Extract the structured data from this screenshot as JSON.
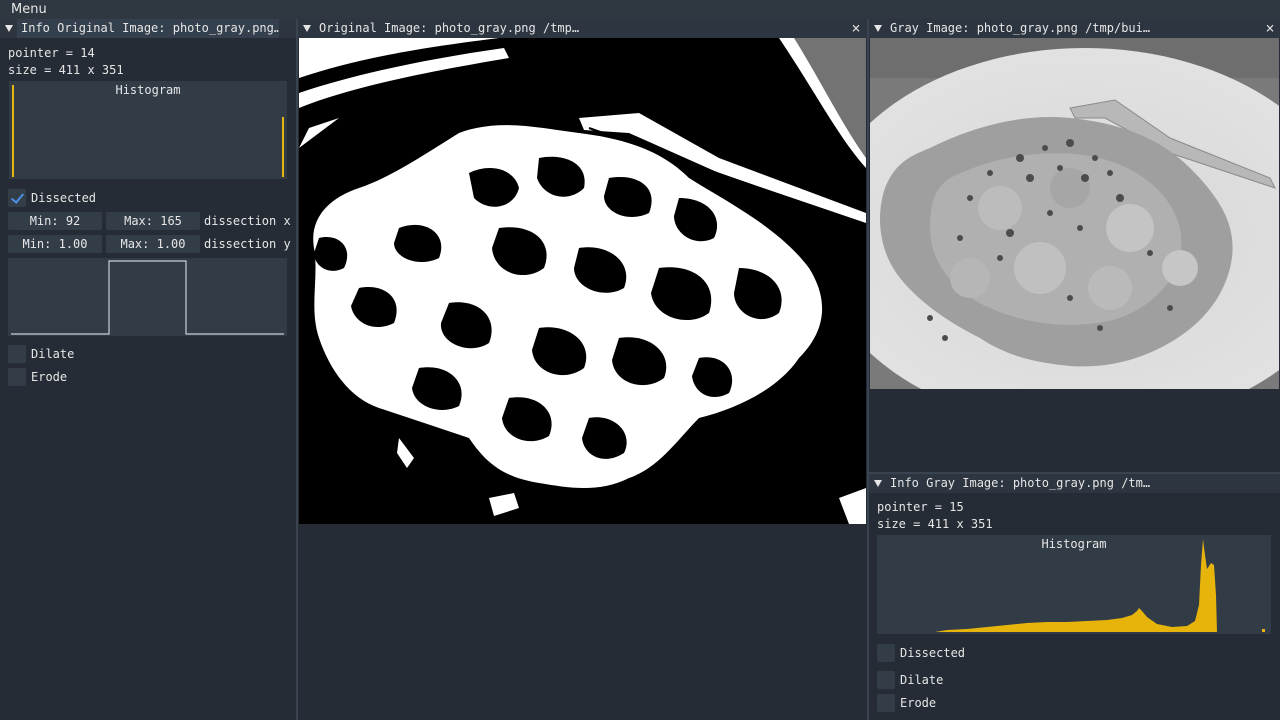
{
  "menu": {
    "label": "Menu"
  },
  "left_panel": {
    "title": "Info Original Image: photo_gray.png…",
    "pointer": "pointer = 14",
    "size": "size = 411 x 351",
    "histogram_title": "Histogram",
    "dissected": {
      "label": "Dissected",
      "checked": true
    },
    "range_x": {
      "min": "Min: 92",
      "max": "Max: 165",
      "label": "dissection x"
    },
    "range_y": {
      "min": "Min: 1.00",
      "max": "Max: 1.00",
      "label": "dissection y"
    },
    "dilate": {
      "label": "Dilate",
      "checked": false
    },
    "erode": {
      "label": "Erode",
      "checked": false
    }
  },
  "center_panel": {
    "title": "Original Image: photo_gray.png /tmp…",
    "close": "×"
  },
  "right_top_panel": {
    "title": "Gray Image: photo_gray.png /tmp/bui…",
    "close": "×"
  },
  "right_bottom_panel": {
    "title": "Info Gray Image: photo_gray.png /tm…",
    "pointer": "pointer = 15",
    "size": "size = 411 x 351",
    "histogram_title": "Histogram",
    "dissected": {
      "label": "Dissected",
      "checked": false
    },
    "dilate": {
      "label": "Dilate",
      "checked": false
    },
    "erode": {
      "label": "Erode",
      "checked": false
    }
  },
  "colors": {
    "histogram": "#e6b40b",
    "background": "#252c35",
    "checkmark": "#4a90e2"
  }
}
